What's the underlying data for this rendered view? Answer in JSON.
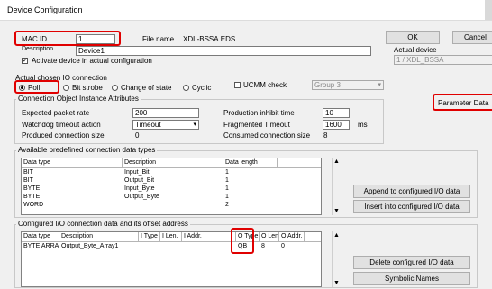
{
  "window": {
    "title": "Device Configuration"
  },
  "device": {
    "mac_id_label": "MAC ID",
    "mac_id_value": "1",
    "file_name_label": "File name",
    "file_name_value": "XDL-BSSA.EDS",
    "description_label": "Description",
    "description_value": "Device1",
    "activate_label": "Activate device in actual configuration",
    "activate_checked": true
  },
  "buttons": {
    "ok": "OK",
    "cancel": "Cancel",
    "parameter_data": "Parameter Data",
    "append": "Append to configured I/O data",
    "insert": "Insert into configured I/O data",
    "delete": "Delete configured I/O data",
    "symbolic": "Symbolic Names"
  },
  "actual_device": {
    "label": "Actual device",
    "value": "1 / XDL_BSSA"
  },
  "io_connection": {
    "label": "Actual chosen IO connection",
    "options": [
      "Poll",
      "Bit strobe",
      "Change of state",
      "Cyclic"
    ],
    "selected": "Poll",
    "ucmm_label": "UCMM check",
    "ucmm_group": "Group 3"
  },
  "attributes": {
    "legend": "Connection Object Instance Attributes",
    "expected_rate_label": "Expected packet rate",
    "expected_rate_value": "200",
    "production_inhibit_label": "Production inhibit time",
    "production_inhibit_value": "10",
    "watchdog_label": "Watchdog timeout action",
    "watchdog_value": "Timeout",
    "fragmented_label": "Fragmented Timeout",
    "fragmented_value": "1600",
    "fragmented_unit": "ms",
    "produced_size_label": "Produced connection size",
    "produced_size_value": "0",
    "consumed_size_label": "Consumed connection size",
    "consumed_size_value": "8"
  },
  "available": {
    "legend": "Available predefined connection data types",
    "columns": [
      "Data type",
      "Description",
      "Data length"
    ],
    "rows": [
      [
        "BIT",
        "Input_Bit",
        "1"
      ],
      [
        "BIT",
        "Output_Bit",
        "1"
      ],
      [
        "BYTE",
        "Input_Byte",
        "1"
      ],
      [
        "BYTE",
        "Output_Byte",
        "1"
      ],
      [
        "WORD",
        "",
        "2"
      ]
    ]
  },
  "configured": {
    "legend": "Configured I/O connection data and its offset address",
    "columns": [
      "Data type",
      "Description",
      "I Type",
      "I Len.",
      "I Addr.",
      "O Type",
      "O Len.",
      "O Addr."
    ],
    "rows": [
      [
        "BYTE ARRAY",
        "Output_Byte_Array1",
        "",
        "",
        "",
        "QB",
        "8",
        "0"
      ]
    ]
  },
  "colors": {
    "highlight": "#e00000"
  }
}
